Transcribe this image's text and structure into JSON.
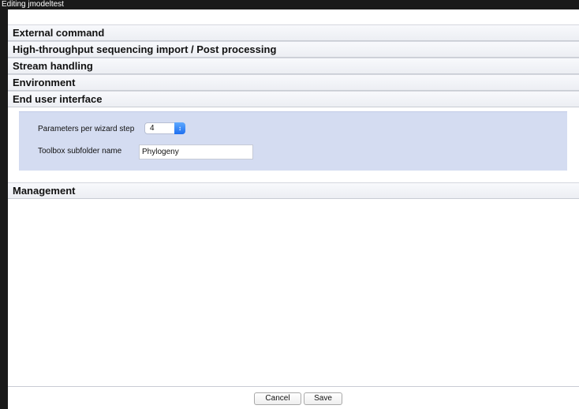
{
  "window": {
    "title": "Editing jmodeltest"
  },
  "sections": [
    {
      "label": "External command"
    },
    {
      "label": "High-throughput sequencing import / Post processing"
    },
    {
      "label": "Stream handling"
    },
    {
      "label": "Environment"
    },
    {
      "label": "End user interface"
    },
    {
      "label": "Management"
    }
  ],
  "end_user_interface": {
    "params_per_step": {
      "label": "Parameters per wizard step",
      "value": "4"
    },
    "toolbox_subfolder": {
      "label": "Toolbox subfolder name",
      "value": "Phylogeny"
    }
  },
  "footer": {
    "cancel_label": "Cancel",
    "save_label": "Save"
  }
}
